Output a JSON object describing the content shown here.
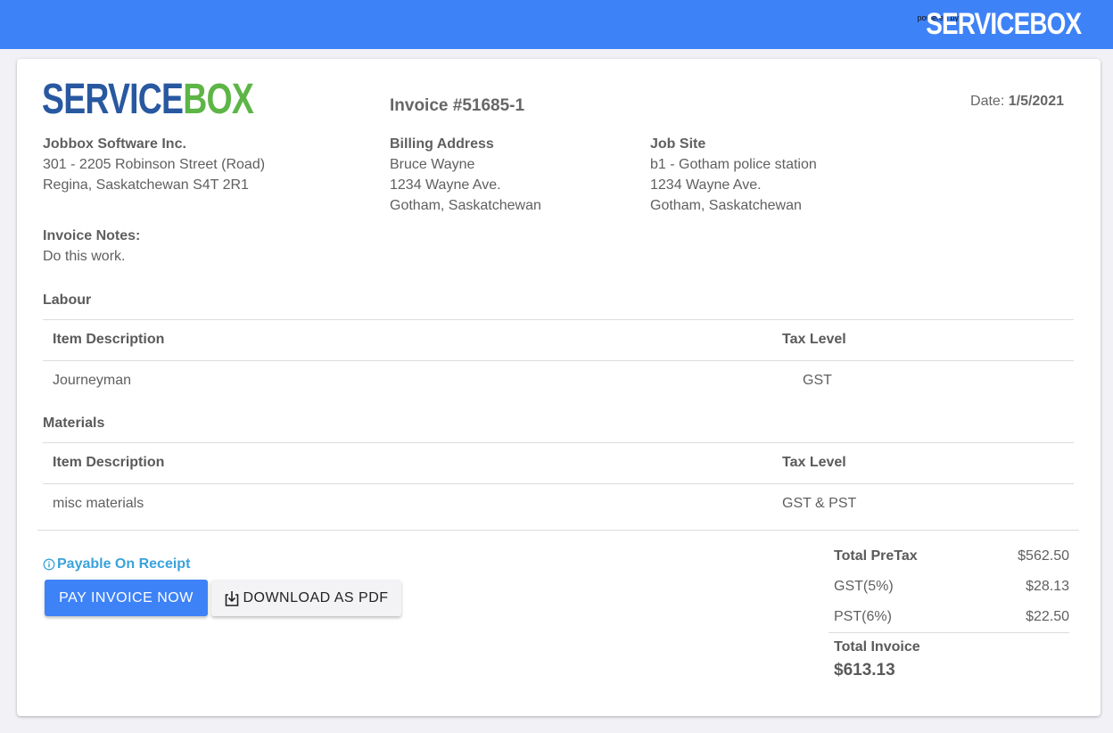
{
  "topbar": {
    "powered_by": "powered by",
    "logo": "SERVICEBOX"
  },
  "brand": {
    "logo_part1": "SERVICE",
    "logo_part2": "BOX",
    "color_service": "#2858a0",
    "color_box": "#5db546"
  },
  "header": {
    "invoice_number": "Invoice #51685-1",
    "date_label": "Date:",
    "date_value": "1/5/2021"
  },
  "company": {
    "name": "Jobbox Software Inc.",
    "address_line1": "301 - 2205 Robinson Street (Road)",
    "address_line2": "Regina, Saskatchewan S4T 2R1"
  },
  "billing": {
    "title": "Billing Address",
    "name": "Bruce Wayne",
    "line1": "1234 Wayne Ave.",
    "line2": "Gotham, Saskatchewan"
  },
  "job_site": {
    "title": "Job Site",
    "name": "b1 - Gotham police station",
    "line1": "1234 Wayne Ave.",
    "line2": "Gotham, Saskatchewan"
  },
  "notes": {
    "title": "Invoice Notes:",
    "text": "Do this work."
  },
  "labour": {
    "title": "Labour",
    "col_description": "Item Description",
    "col_tax": "Tax Level",
    "rows": [
      {
        "description": "Journeyman",
        "tax": "GST"
      }
    ]
  },
  "materials": {
    "title": "Materials",
    "col_description": "Item Description",
    "col_tax": "Tax Level",
    "rows": [
      {
        "description": "misc materials",
        "tax": "GST & PST"
      }
    ]
  },
  "payment": {
    "payable_label": "Payable On Receipt",
    "info_icon": "info-icon",
    "pay_button": "PAY INVOICE NOW",
    "pdf_button": "DOWNLOAD AS PDF",
    "download_icon": "download-icon",
    "accent_color": "#3e82f7",
    "payable_color": "#3aa2dc"
  },
  "totals": {
    "pretax_label": "Total PreTax",
    "pretax_value": "$562.50",
    "gst_label": "GST(5%)",
    "gst_value": "$28.13",
    "pst_label": "PST(6%)",
    "pst_value": "$22.50",
    "total_label": "Total Invoice",
    "total_value": "$613.13"
  }
}
